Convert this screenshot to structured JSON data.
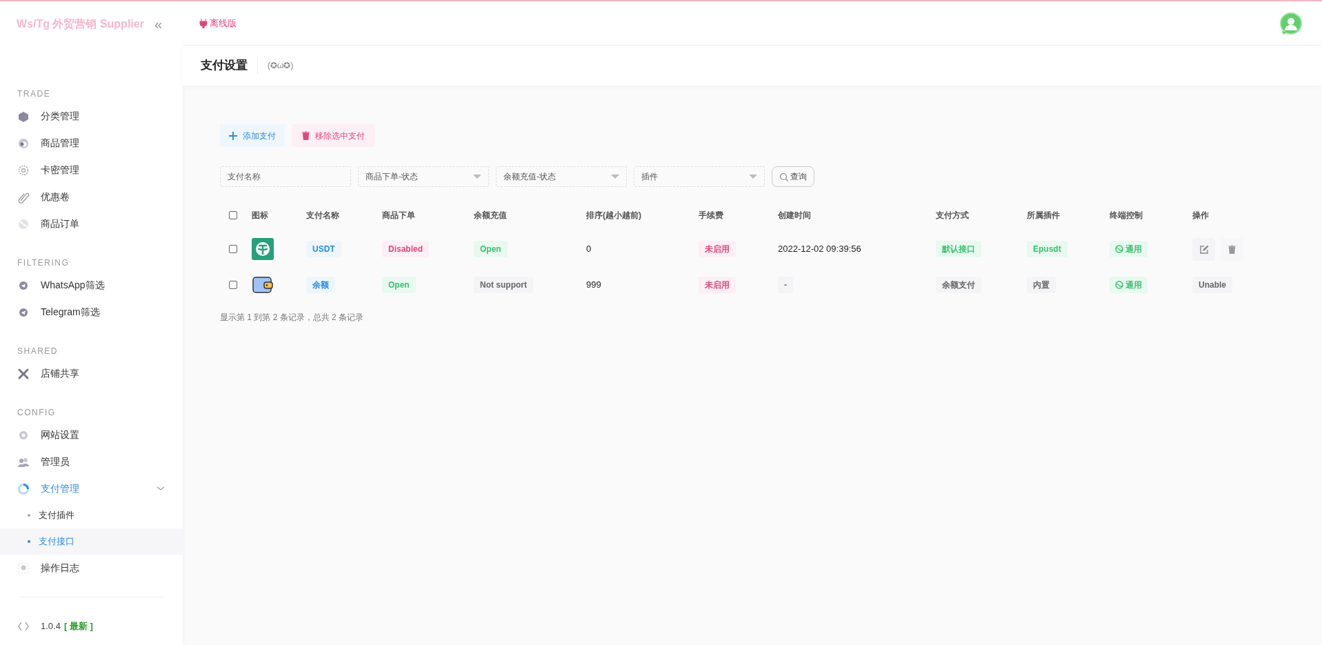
{
  "sidebar": {
    "brand": "Ws/Tg 外贸营销 Supplier",
    "collapse_glyph": "«",
    "sections": [
      {
        "title": "TRADE",
        "items": [
          {
            "label": "分类管理",
            "selected": false
          },
          {
            "label": "商品管理",
            "selected": false
          },
          {
            "label": "卡密管理",
            "selected": false
          },
          {
            "label": "优惠卷",
            "selected": false
          },
          {
            "label": "商品订单",
            "selected": false
          }
        ]
      },
      {
        "title": "FILTERING",
        "items": [
          {
            "label": "WhatsApp筛选",
            "selected": false
          },
          {
            "label": "Telegram筛选",
            "selected": false
          }
        ]
      },
      {
        "title": "SHARED",
        "items": [
          {
            "label": "店铺共享",
            "selected": false
          }
        ]
      },
      {
        "title": "CONFIG",
        "items": [
          {
            "label": "网站设置",
            "selected": false
          },
          {
            "label": "管理员",
            "selected": false
          },
          {
            "label": "支付管理",
            "selected": true,
            "expanded": true,
            "children": [
              {
                "label": "支付插件",
                "selected": false
              },
              {
                "label": "支付接口",
                "selected": true
              }
            ]
          },
          {
            "label": "操作日志",
            "selected": false
          }
        ]
      }
    ],
    "version": "1.0.4",
    "version_tag": "[ 最新 ]"
  },
  "topbar": {
    "mode": "离线版"
  },
  "page": {
    "title": "支付设置",
    "emoticon": "(✪ω✪)"
  },
  "toolbar": {
    "add": "添加支付",
    "remove": "移除选中支付"
  },
  "filters": {
    "name_placeholder": "支付名称",
    "selects": [
      "商品下单-状态",
      "余额充值-状态",
      "插件"
    ],
    "search": "查询"
  },
  "table": {
    "select_all": {
      "checked": false
    },
    "columns": [
      "图标",
      "支付名称",
      "商品下单",
      "余额充值",
      "排序(越小越前)",
      "手续费",
      "创建时间",
      "支付方式",
      "所属插件",
      "终端控制",
      "操作"
    ],
    "rows": [
      {
        "checked": false,
        "name": {
          "text": "USDT",
          "kind": "blue"
        },
        "order": {
          "text": "Disabled",
          "kind": "red"
        },
        "recharge": {
          "text": "Open",
          "kind": "green"
        },
        "sort": "0",
        "fee": {
          "text": "未启用",
          "kind": "red"
        },
        "created": {
          "text": "2022-12-02 09:39:56",
          "kind": "plain"
        },
        "method": {
          "text": "默认接口",
          "kind": "green"
        },
        "plugin": {
          "text": "Epusdt",
          "kind": "green"
        },
        "terminal": {
          "text": "通用",
          "kind": "green"
        },
        "actions": [
          {
            "kind": "edit"
          },
          {
            "kind": "delete"
          }
        ]
      },
      {
        "checked": false,
        "name": {
          "text": "余额",
          "kind": "blue"
        },
        "order": {
          "text": "Open",
          "kind": "green"
        },
        "recharge": {
          "text": "Not support",
          "kind": "gray"
        },
        "sort": "999",
        "fee": {
          "text": "未启用",
          "kind": "red"
        },
        "created": {
          "text": "-",
          "kind": "gray"
        },
        "method": {
          "text": "余额支付",
          "kind": "gray"
        },
        "plugin": {
          "text": "内置",
          "kind": "gray"
        },
        "terminal": {
          "text": "通用",
          "kind": "green"
        },
        "actions": [
          {
            "kind": "label",
            "text": "Unable"
          }
        ]
      }
    ],
    "summary": "显示第 1 到第 2 条记录，总共 2 条记录"
  }
}
